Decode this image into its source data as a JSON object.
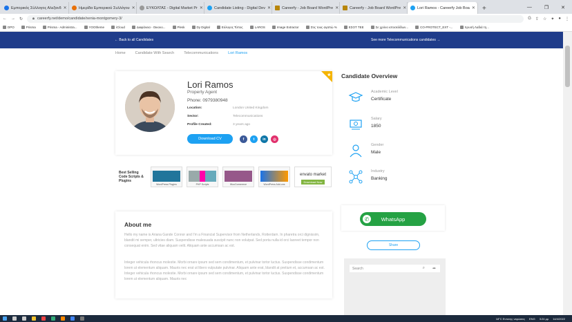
{
  "browser": {
    "tabs": [
      {
        "label": "Εμπορικός Σύλλογος Αλεξανδ"
      },
      {
        "label": "Ημερίδα Εμπορικού Συλλόγου"
      },
      {
        "label": "ΕΥΚΟΛΤΑΣ - Digital Market Pr"
      },
      {
        "label": "Candidate Listing - Digital Dev"
      },
      {
        "label": "Careerfy - Job Board WordPre"
      },
      {
        "label": "Careerfy - Job Board WordPre"
      },
      {
        "label": "Lori Ramos - Careerfy Job Boa"
      }
    ],
    "new_tab": "+",
    "url": "careerfy.net/demo/candidate/xenia-montgomery-3/",
    "bookmarks": [
      "DPO",
      "Prisma",
      "Prisma - Administra...",
      "YOOtheme",
      "iCloud",
      "Διαφάνεια - Οικονο...",
      "Plesk",
      "Dy Digital",
      "Εύλογος Τύπος",
      "LAROS",
      "Image Extractor",
      "Στις τους αγαπώ %",
      "ΕΣΟΤ ΤΕΕ",
      "Σε χρόνο ιστοσελίδων...",
      "CO-PROTECT_EXT -...",
      "Χρυσή Λαδιά τη..."
    ],
    "window_controls": [
      "—",
      "❐",
      "✕"
    ]
  },
  "site_bar": {
    "back": "← Back to all Candidates",
    "more": "See more Telecommunications candidates →"
  },
  "breadcrumb": [
    "Home",
    "Candidate With Search",
    "Telecommunications",
    "Lori Ramos"
  ],
  "profile": {
    "name": "Lori Ramos",
    "role": "Property Agent",
    "phone": "Phone: 0979380948",
    "location_label": "Location:",
    "location_value": "London United Kingdom",
    "sector_label": "Sector:",
    "sector_value": "Telecommunications",
    "created_label": "Profile Created:",
    "created_value": "3 years ago",
    "download_cv": "Download CV",
    "social": [
      "f",
      "t",
      "in",
      "◎"
    ]
  },
  "ads": {
    "label": "Best Selling Code Scripts & Plugins",
    "items": [
      "WordPress Plugins",
      "PHP Scripts",
      "WooCommerce",
      "WordPress Add-ons",
      "Download Now"
    ],
    "envato": "envato market"
  },
  "about": {
    "title": "About me",
    "p1": "Hello my name is Ariana Gande Connor and I'm a Financial Supervisor from Netherlands, Rotterdam. In pharetra orci dignissim, blandit mi semper, ultricies diam. Suspendisse malesuada suscipit nunc non volutpat. Sed porta nulla id orci laoreet tempor non consequat enim. Sed vitae aliquam velit. Aliquam ante accumsan ac est.",
    "p2": "Integer vehicula rhoncus molestie. Morbi ornare ipsum sed sem condimentum, et pulvinar tortor luctus. Suspendisse condimentum lorem ut elementum aliquam. Mauris nec erat ut libero vulputate pulvinar. Aliquam ante erat, blandit at pretium et, accumsan ac est. Integer vehicula rhoncus molestie. Morbi ornare ipsum sed sem condimentum, et pulvinar tortor luctus. Suspendisse condimentum lorem ut elementum aliquam. Mauris nec"
  },
  "overview": {
    "title": "Candidate Overview",
    "items": [
      {
        "key": "Academic Level",
        "value": "Certificate",
        "icon": "graduation-cap-icon"
      },
      {
        "key": "Salary",
        "value": "1850",
        "icon": "money-icon"
      },
      {
        "key": "Gender",
        "value": "Male",
        "icon": "person-icon"
      },
      {
        "key": "Industry",
        "value": "Banking",
        "icon": "network-icon"
      }
    ]
  },
  "whatsapp": "WhatsApp",
  "share": "Share",
  "search": {
    "placeholder": "Search"
  },
  "taskbar": {
    "weather": "18°C Εντονης νεφώσεις",
    "lang": "ENG",
    "time": "3:24 μμ",
    "date": "14/4/2022"
  },
  "colors": {
    "primary": "#1da1f2",
    "navy": "#1f3c8a",
    "whatsapp": "#25a244",
    "ribbon": "#f5b400"
  }
}
